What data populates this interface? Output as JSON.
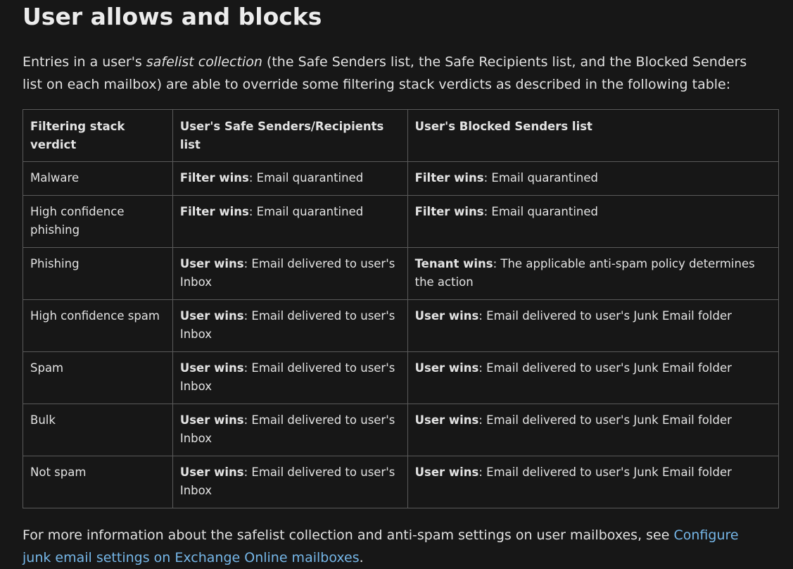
{
  "heading": "User allows and blocks",
  "intro": {
    "before": "Entries in a user's ",
    "term": "safelist collection",
    "after": " (the Safe Senders list, the Safe Recipients list, and the Blocked Senders list on each mailbox) are able to override some filtering stack verdicts as described in the following table:"
  },
  "table": {
    "headers": [
      "Filtering stack verdict",
      "User's Safe Senders/Recipients list",
      "User's Blocked Senders list"
    ],
    "rows": [
      {
        "verdict": "Malware",
        "safe": {
          "key": "Filter wins",
          "text": ": Email quarantined"
        },
        "blocked": {
          "key": "Filter wins",
          "text": ": Email quarantined"
        }
      },
      {
        "verdict": "High confidence phishing",
        "safe": {
          "key": "Filter wins",
          "text": ": Email quarantined"
        },
        "blocked": {
          "key": "Filter wins",
          "text": ": Email quarantined"
        }
      },
      {
        "verdict": "Phishing",
        "safe": {
          "key": "User wins",
          "text": ": Email delivered to user's Inbox"
        },
        "blocked": {
          "key": "Tenant wins",
          "text": ": The applicable anti-spam policy determines the action"
        }
      },
      {
        "verdict": "High confidence spam",
        "safe": {
          "key": "User wins",
          "text": ": Email delivered to user's Inbox"
        },
        "blocked": {
          "key": "User wins",
          "text": ": Email delivered to user's Junk Email folder"
        }
      },
      {
        "verdict": "Spam",
        "safe": {
          "key": "User wins",
          "text": ": Email delivered to user's Inbox"
        },
        "blocked": {
          "key": "User wins",
          "text": ": Email delivered to user's Junk Email folder"
        }
      },
      {
        "verdict": "Bulk",
        "safe": {
          "key": "User wins",
          "text": ": Email delivered to user's Inbox"
        },
        "blocked": {
          "key": "User wins",
          "text": ": Email delivered to user's Junk Email folder"
        }
      },
      {
        "verdict": "Not spam",
        "safe": {
          "key": "User wins",
          "text": ": Email delivered to user's Inbox"
        },
        "blocked": {
          "key": "User wins",
          "text": ": Email delivered to user's Junk Email folder"
        }
      }
    ]
  },
  "outro": {
    "text": "For more information about the safelist collection and anti-spam settings on user mailboxes, see ",
    "link_text": "Configure junk email settings on Exchange Online mailboxes",
    "end": "."
  },
  "colors": {
    "background": "#171717",
    "link": "#75b6e7"
  }
}
